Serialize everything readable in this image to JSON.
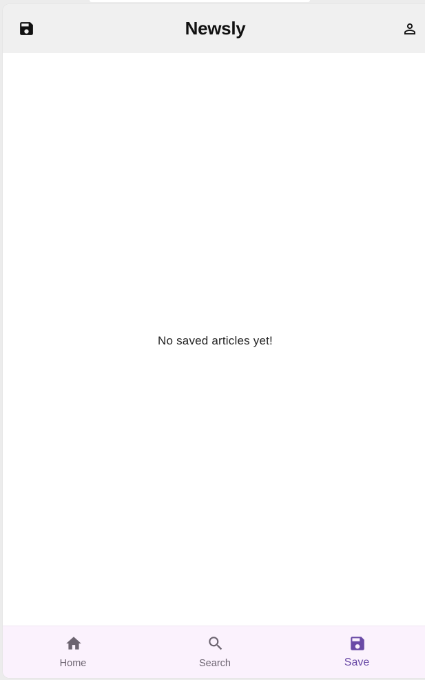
{
  "app_bar": {
    "title": "Newsly",
    "left_icon": "save-icon",
    "right_icon": "person-icon"
  },
  "content": {
    "empty_message": "No saved articles yet!"
  },
  "bottom_nav": {
    "items": [
      {
        "label": "Home",
        "icon": "home-icon",
        "active": false
      },
      {
        "label": "Search",
        "icon": "search-icon",
        "active": false
      },
      {
        "label": "Save",
        "icon": "save-icon",
        "active": true
      }
    ]
  },
  "colors": {
    "app_bar_bg": "#f0f0f0",
    "nav_bg": "#fbf2fd",
    "active": "#6a4aa6",
    "inactive": "#6c6470"
  }
}
